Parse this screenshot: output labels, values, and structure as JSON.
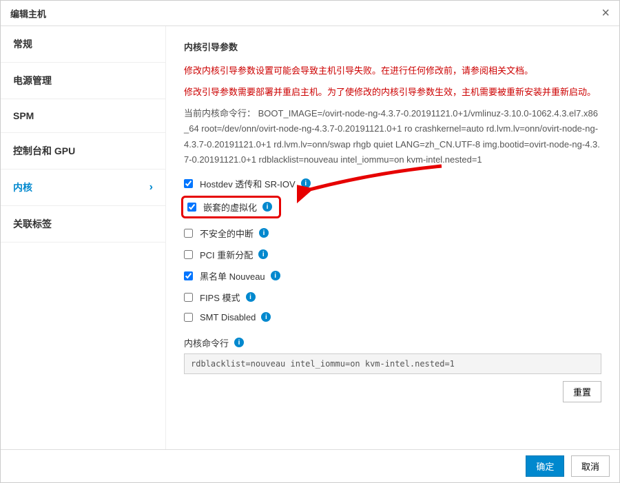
{
  "header": {
    "title": "编辑主机"
  },
  "sidebar": {
    "items": [
      {
        "label": "常规"
      },
      {
        "label": "电源管理"
      },
      {
        "label": "SPM"
      },
      {
        "label": "控制台和 GPU"
      },
      {
        "label": "内核"
      },
      {
        "label": "关联标签"
      }
    ]
  },
  "content": {
    "section_title": "内核引导参数",
    "warning1": "修改内核引导参数设置可能会导致主机引导失败。在进行任何修改前，请参阅相关文档。",
    "warning2": "修改引导参数需要部署并重启主机。为了使修改的内核引导参数生效，主机需要被重新安装并重新启动。",
    "current_kernel_label": "当前内核命令行：",
    "current_kernel_value": "BOOT_IMAGE=/ovirt-node-ng-4.3.7-0.20191121.0+1/vmlinuz-3.10.0-1062.4.3.el7.x86_64 root=/dev/onn/ovirt-node-ng-4.3.7-0.20191121.0+1 ro crashkernel=auto rd.lvm.lv=onn/ovirt-node-ng-4.3.7-0.20191121.0+1 rd.lvm.lv=onn/swap rhgb quiet LANG=zh_CN.UTF-8 img.bootid=ovirt-node-ng-4.3.7-0.20191121.0+1 rdblacklist=nouveau intel_iommu=on kvm-intel.nested=1",
    "options": [
      {
        "label": "Hostdev 透传和 SR-IOV",
        "checked": true
      },
      {
        "label": "嵌套的虚拟化",
        "checked": true,
        "highlight": true
      },
      {
        "label": "不安全的中断",
        "checked": false
      },
      {
        "label": "PCI 重新分配",
        "checked": false
      },
      {
        "label": "黑名单 Nouveau",
        "checked": true
      },
      {
        "label": "FIPS 模式",
        "checked": false
      },
      {
        "label": "SMT Disabled",
        "checked": false
      }
    ],
    "cmdline_label": "内核命令行",
    "cmdline_value": "rdblacklist=nouveau intel_iommu=on kvm-intel.nested=1",
    "reset_btn": "重置"
  },
  "footer": {
    "ok": "确定",
    "cancel": "取消"
  }
}
